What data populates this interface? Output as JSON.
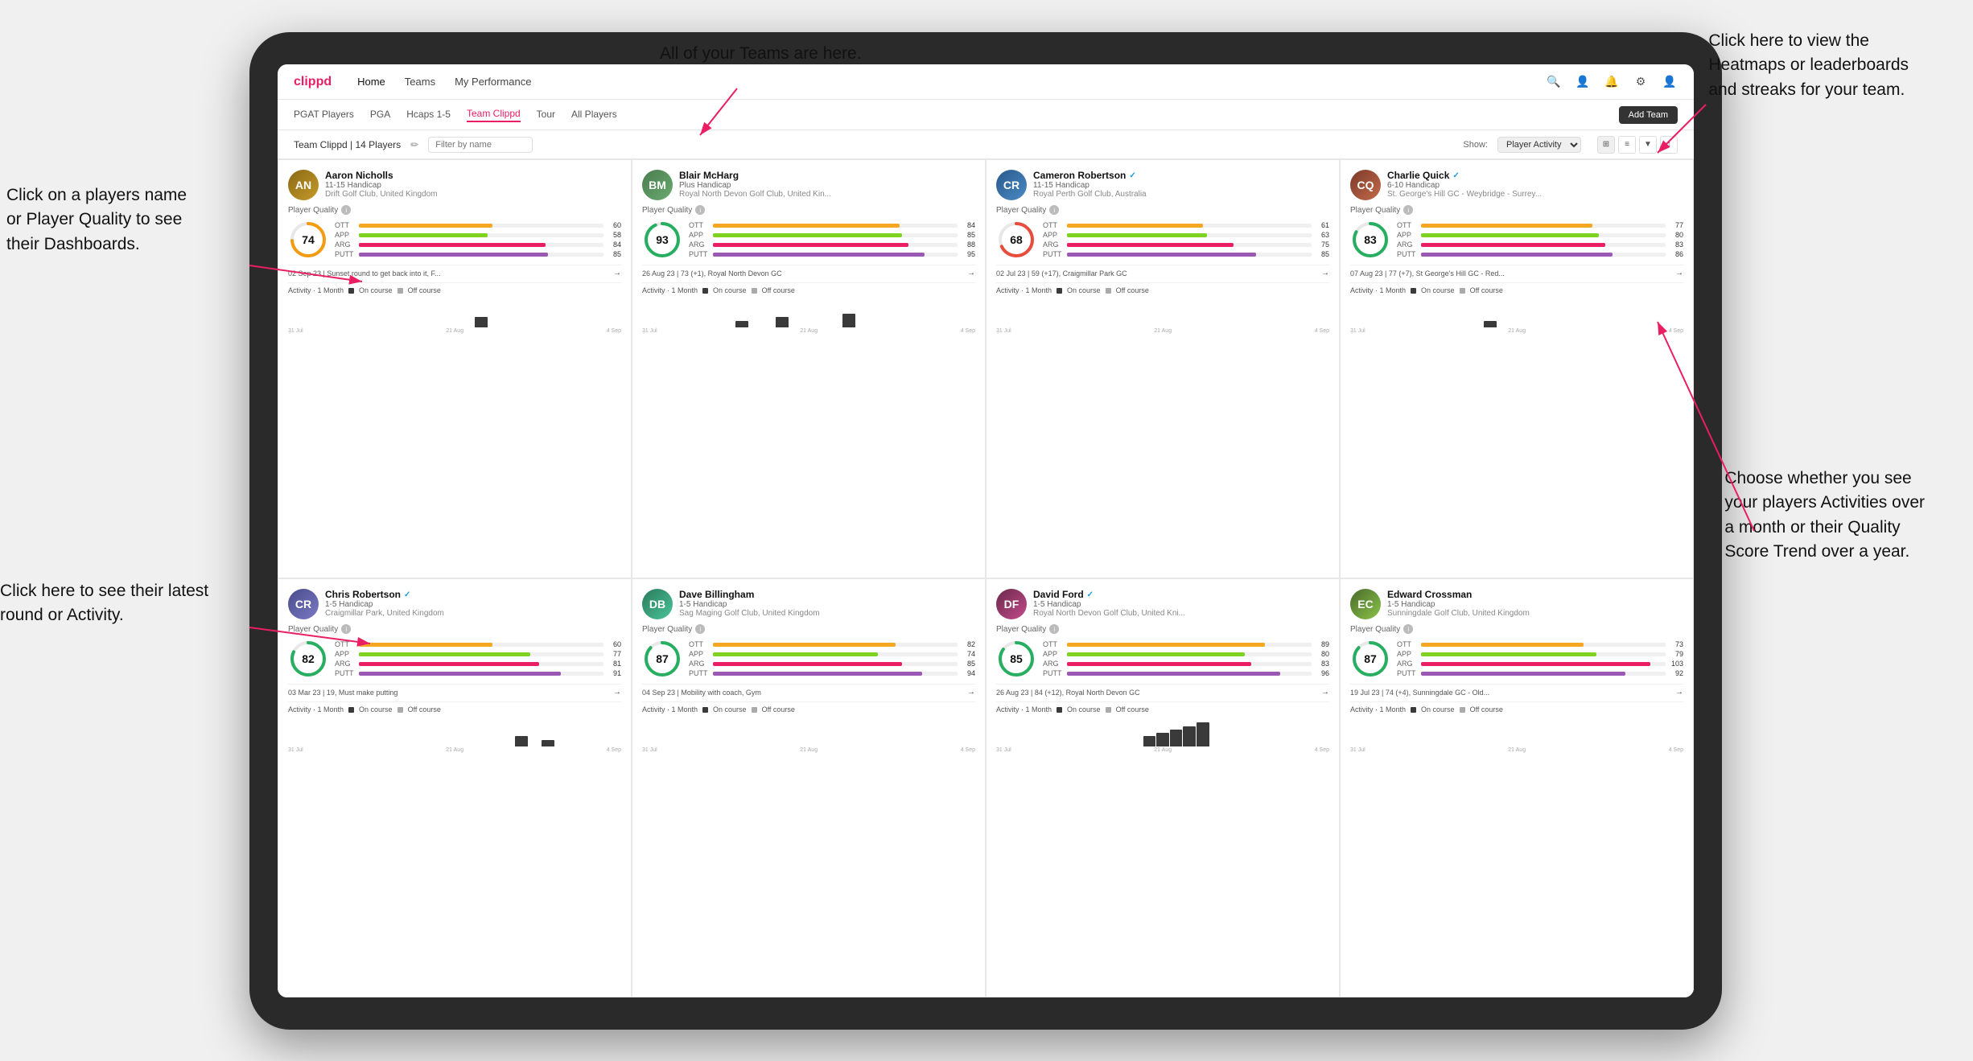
{
  "annotations": {
    "teams_tooltip": "All of your Teams are here.",
    "heatmaps_tooltip_line1": "Click here to view the",
    "heatmaps_tooltip_line2": "Heatmaps or leaderboards",
    "heatmaps_tooltip_line3": "and streaks for your team.",
    "players_name_tooltip_line1": "Click on a players name",
    "players_name_tooltip_line2": "or Player Quality to see",
    "players_name_tooltip_line3": "their Dashboards.",
    "latest_round_tooltip_line1": "Click here to see their latest",
    "latest_round_tooltip_line2": "round or Activity.",
    "activities_tooltip_line1": "Choose whether you see",
    "activities_tooltip_line2": "your players Activities over",
    "activities_tooltip_line3": "a month or their Quality",
    "activities_tooltip_line4": "Score Trend over a year."
  },
  "nav": {
    "logo": "clippd",
    "items": [
      "Home",
      "Teams",
      "My Performance"
    ],
    "sub_items": [
      "PGAT Players",
      "PGA",
      "Hcaps 1-5",
      "Team Clippd",
      "Tour",
      "All Players"
    ],
    "active_sub": "Team Clippd",
    "add_team_label": "Add Team"
  },
  "team_bar": {
    "label": "Team Clippd | 14 Players",
    "filter_placeholder": "Filter by name",
    "show_label": "Show:",
    "show_option": "Player Activity"
  },
  "players": [
    {
      "name": "Aaron Nicholls",
      "handicap": "11-15 Handicap",
      "club": "Drift Golf Club, United Kingdom",
      "score": 74,
      "score_color": "#1a9bdb",
      "ott": 60,
      "app": 58,
      "arg": 84,
      "putt": 85,
      "last_round": "02 Sep 23 | Sunset round to get back into it, F...",
      "avatar_class": "avatar-aaron",
      "avatar_initials": "AN",
      "bars": [
        {
          "label": "OTT",
          "value": 60,
          "color": "#f5a623"
        },
        {
          "label": "APP",
          "value": 58,
          "color": "#7ed321"
        },
        {
          "label": "ARG",
          "value": 84,
          "color": "#e91e63"
        },
        {
          "label": "PUTT",
          "value": 85,
          "color": "#9b59b6"
        }
      ],
      "chart_data": [
        0,
        0,
        0,
        0,
        0,
        0,
        0,
        0,
        0,
        0,
        0,
        0,
        0,
        0,
        3,
        0,
        0,
        0,
        0,
        0,
        0,
        0,
        0,
        0,
        0
      ]
    },
    {
      "name": "Blair McHarg",
      "handicap": "Plus Handicap",
      "club": "Royal North Devon Golf Club, United Kin...",
      "score": 93,
      "score_color": "#27ae60",
      "ott": 84,
      "app": 85,
      "arg": 88,
      "putt": 95,
      "last_round": "26 Aug 23 | 73 (+1), Royal North Devon GC",
      "avatar_class": "avatar-blair",
      "avatar_initials": "BM",
      "bars": [
        {
          "label": "OTT",
          "value": 84,
          "color": "#f5a623"
        },
        {
          "label": "APP",
          "value": 85,
          "color": "#7ed321"
        },
        {
          "label": "ARG",
          "value": 88,
          "color": "#e91e63"
        },
        {
          "label": "PUTT",
          "value": 95,
          "color": "#9b59b6"
        }
      ],
      "chart_data": [
        0,
        0,
        0,
        0,
        0,
        0,
        0,
        2,
        0,
        0,
        3,
        0,
        0,
        0,
        0,
        4,
        0,
        0,
        0,
        0,
        0,
        0,
        0,
        0,
        0
      ]
    },
    {
      "name": "Cameron Robertson",
      "handicap": "11-15 Handicap",
      "club": "Royal Perth Golf Club, Australia",
      "score": 68,
      "score_color": "#f39c12",
      "ott": 61,
      "app": 63,
      "arg": 75,
      "putt": 85,
      "last_round": "02 Jul 23 | 59 (+17), Craigmillar Park GC",
      "avatar_class": "avatar-cameron",
      "avatar_initials": "CR",
      "verified": true,
      "bars": [
        {
          "label": "OTT",
          "value": 61,
          "color": "#f5a623"
        },
        {
          "label": "APP",
          "value": 63,
          "color": "#7ed321"
        },
        {
          "label": "ARG",
          "value": 75,
          "color": "#e91e63"
        },
        {
          "label": "PUTT",
          "value": 85,
          "color": "#9b59b6"
        }
      ],
      "chart_data": [
        0,
        0,
        0,
        0,
        0,
        0,
        0,
        0,
        0,
        0,
        0,
        0,
        0,
        0,
        0,
        0,
        0,
        0,
        0,
        0,
        0,
        0,
        0,
        0,
        0
      ]
    },
    {
      "name": "Charlie Quick",
      "handicap": "6-10 Handicap",
      "club": "St. George's Hill GC - Weybridge - Surrey...",
      "score": 83,
      "score_color": "#27ae60",
      "ott": 77,
      "app": 80,
      "arg": 83,
      "putt": 86,
      "last_round": "07 Aug 23 | 77 (+7), St George's Hill GC - Red...",
      "avatar_class": "avatar-charlie",
      "avatar_initials": "CQ",
      "verified": true,
      "bars": [
        {
          "label": "OTT",
          "value": 77,
          "color": "#f5a623"
        },
        {
          "label": "APP",
          "value": 80,
          "color": "#7ed321"
        },
        {
          "label": "ARG",
          "value": 83,
          "color": "#e91e63"
        },
        {
          "label": "PUTT",
          "value": 86,
          "color": "#9b59b6"
        }
      ],
      "chart_data": [
        0,
        0,
        0,
        0,
        0,
        0,
        0,
        0,
        0,
        0,
        2,
        0,
        0,
        0,
        0,
        0,
        0,
        0,
        0,
        0,
        0,
        0,
        0,
        0,
        0
      ]
    },
    {
      "name": "Chris Robertson",
      "handicap": "1-5 Handicap",
      "club": "Craigmillar Park, United Kingdom",
      "score": 82,
      "score_color": "#27ae60",
      "ott": 60,
      "app": 77,
      "arg": 81,
      "putt": 91,
      "last_round": "03 Mar 23 | 19, Must make putting",
      "avatar_class": "avatar-chris",
      "avatar_initials": "CR",
      "verified": true,
      "bars": [
        {
          "label": "OTT",
          "value": 60,
          "color": "#f5a623"
        },
        {
          "label": "APP",
          "value": 77,
          "color": "#7ed321"
        },
        {
          "label": "ARG",
          "value": 81,
          "color": "#e91e63"
        },
        {
          "label": "PUTT",
          "value": 91,
          "color": "#9b59b6"
        }
      ],
      "chart_data": [
        0,
        0,
        0,
        0,
        0,
        0,
        0,
        0,
        0,
        0,
        0,
        0,
        0,
        0,
        0,
        0,
        0,
        3,
        0,
        2,
        0,
        0,
        0,
        0,
        0
      ]
    },
    {
      "name": "Dave Billingham",
      "handicap": "1-5 Handicap",
      "club": "Sag Maging Golf Club, United Kingdom",
      "score": 87,
      "score_color": "#27ae60",
      "ott": 82,
      "app": 74,
      "arg": 85,
      "putt": 94,
      "last_round": "04 Sep 23 | Mobility with coach, Gym",
      "avatar_class": "avatar-dave",
      "avatar_initials": "DB",
      "bars": [
        {
          "label": "OTT",
          "value": 82,
          "color": "#f5a623"
        },
        {
          "label": "APP",
          "value": 74,
          "color": "#7ed321"
        },
        {
          "label": "ARG",
          "value": 85,
          "color": "#e91e63"
        },
        {
          "label": "PUTT",
          "value": 94,
          "color": "#9b59b6"
        }
      ],
      "chart_data": [
        0,
        0,
        0,
        0,
        0,
        0,
        0,
        0,
        0,
        0,
        0,
        0,
        0,
        0,
        0,
        0,
        0,
        0,
        0,
        0,
        0,
        0,
        0,
        0,
        0
      ]
    },
    {
      "name": "David Ford",
      "handicap": "1-5 Handicap",
      "club": "Royal North Devon Golf Club, United Kni...",
      "score": 85,
      "score_color": "#27ae60",
      "ott": 89,
      "app": 80,
      "arg": 83,
      "putt": 96,
      "last_round": "26 Aug 23 | 84 (+12), Royal North Devon GC",
      "avatar_class": "avatar-david",
      "avatar_initials": "DF",
      "verified": true,
      "bars": [
        {
          "label": "OTT",
          "value": 89,
          "color": "#f5a623"
        },
        {
          "label": "APP",
          "value": 80,
          "color": "#7ed321"
        },
        {
          "label": "ARG",
          "value": 83,
          "color": "#e91e63"
        },
        {
          "label": "PUTT",
          "value": 96,
          "color": "#9b59b6"
        }
      ],
      "chart_data": [
        0,
        0,
        0,
        0,
        0,
        0,
        0,
        0,
        0,
        0,
        0,
        3,
        4,
        5,
        6,
        7,
        0,
        0,
        0,
        0,
        0,
        0,
        0,
        0,
        0
      ]
    },
    {
      "name": "Edward Crossman",
      "handicap": "1-5 Handicap",
      "club": "Sunningdale Golf Club, United Kingdom",
      "score": 87,
      "score_color": "#27ae60",
      "ott": 73,
      "app": 79,
      "arg": 103,
      "putt": 92,
      "last_round": "19 Jul 23 | 74 (+4), Sunningdale GC - Old...",
      "avatar_class": "avatar-edward",
      "avatar_initials": "EC",
      "bars": [
        {
          "label": "OTT",
          "value": 73,
          "color": "#f5a623"
        },
        {
          "label": "APP",
          "value": 79,
          "color": "#7ed321"
        },
        {
          "label": "ARG",
          "value": 103,
          "color": "#e91e63"
        },
        {
          "label": "PUTT",
          "value": 92,
          "color": "#9b59b6"
        }
      ],
      "chart_data": [
        0,
        0,
        0,
        0,
        0,
        0,
        0,
        0,
        0,
        0,
        0,
        0,
        0,
        0,
        0,
        0,
        0,
        0,
        0,
        0,
        0,
        0,
        0,
        0,
        0
      ]
    }
  ],
  "activity_labels": {
    "title": "Activity · 1 Month",
    "on_course": "On course",
    "off_course": "Off course"
  },
  "chart_x_labels": [
    "31 Jul",
    "21 Aug",
    "4 Sep"
  ]
}
